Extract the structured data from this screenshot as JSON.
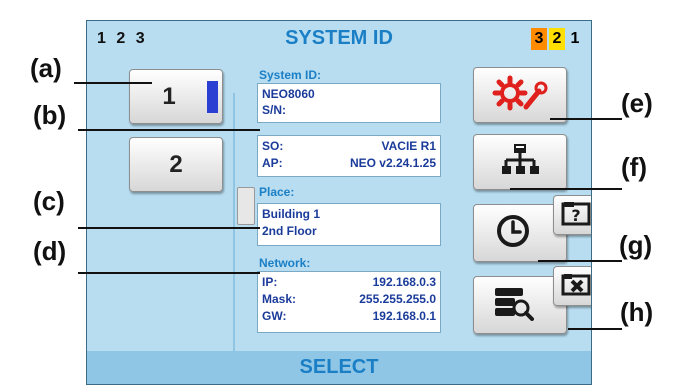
{
  "title": "SYSTEM ID",
  "page_indicator_left": "1 2 3",
  "page_indicator_right": [
    "3",
    "2",
    "1"
  ],
  "channels": [
    "1",
    "2"
  ],
  "info": {
    "system_id_label": "System ID:",
    "system_id_value": "NEO8060",
    "sn_label": "S/N:",
    "so_label": "SO:",
    "so_value": "VACIE R1",
    "ap_label": "AP:",
    "ap_value": "NEO v2.24.1.25",
    "place_label": "Place:",
    "place_line1": "Building 1",
    "place_line2": "2nd Floor",
    "network_label": "Network:",
    "ip_label": "IP:",
    "ip_value": "192.168.0.3",
    "mask_label": "Mask:",
    "mask_value": "255.255.255.0",
    "gw_label": "GW:",
    "gw_value": "192.168.0.1"
  },
  "buttons": {
    "settings_icon": "gear-wrench-icon",
    "network_icon": "network-tree-icon",
    "clock_icon": "clock-icon",
    "help_icon": "question-key-icon",
    "search_icon": "server-search-icon",
    "delete_icon": "delete-key-icon"
  },
  "select_label": "SELECT",
  "annotations": [
    "(a)",
    "(b)",
    "(c)",
    "(d)",
    "(e)",
    "(f)",
    "(g)",
    "(h)"
  ],
  "colors": {
    "screen_bg": "#b8ddf1",
    "title_blue": "#1b7fc6",
    "value_blue": "#1a3b9a",
    "indicator_blue": "#2b3fd3",
    "icon_red": "#e0201c",
    "page_orange": "#ff8c00",
    "page_yellow": "#ffdf00"
  }
}
